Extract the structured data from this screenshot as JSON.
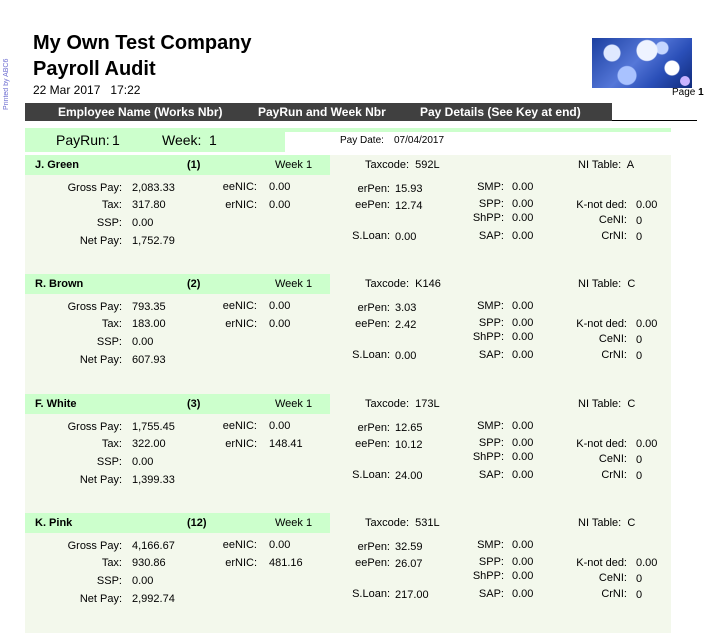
{
  "side_label": "Printed by ABC6",
  "company": "My Own Test Company",
  "report_title": "Payroll Audit",
  "date": "22 Mar 2017",
  "time": "17:22",
  "page": {
    "label": "Page",
    "number": "1"
  },
  "logo": "logo-image",
  "columns": {
    "employee": "Employee Name (Works Nbr)",
    "payrun": "PayRun and Week Nbr",
    "details": "Pay Details (See Key at end)"
  },
  "payrun": {
    "payrun_label": "PayRun:",
    "payrun_value": "1",
    "week_label": "Week:",
    "week_value": "1"
  },
  "pay_date": {
    "label": "Pay Date:",
    "value": "07/04/2017"
  },
  "labels": {
    "gross": "Gross Pay:",
    "tax": "Tax:",
    "ssp": "SSP:",
    "net": "Net Pay:",
    "eenic": "eeNIC:",
    "ernic": "erNIC:",
    "erpen": "erPen:",
    "eepen": "eePen:",
    "sloan": "S.Loan:",
    "smp": "SMP:",
    "spp": "SPP:",
    "shpp": "ShPP:",
    "sap": "SAP:",
    "knotded": "K-not ded:",
    "ceni": "CeNI:",
    "crni": "CrNI:",
    "week": "Week",
    "taxcode": "Taxcode:",
    "nitable": "NI Table:"
  },
  "employees": [
    {
      "name": "J. Green",
      "nbr": "(1)",
      "week": "1",
      "taxcode": "592L",
      "ni_table": "A",
      "gross": "2,083.33",
      "tax": "317.80",
      "ssp": "0.00",
      "net": "1,752.79",
      "eenic": "0.00",
      "ernic": "0.00",
      "erpen": "15.93",
      "eepen": "12.74",
      "sloan": "0.00",
      "smp": "0.00",
      "spp": "0.00",
      "shpp": "0.00",
      "sap": "0.00",
      "knotded": "0.00",
      "ceni": "0",
      "crni": "0"
    },
    {
      "name": "R. Brown",
      "nbr": "(2)",
      "week": "1",
      "taxcode": "K146",
      "ni_table": "C",
      "gross": "793.35",
      "tax": "183.00",
      "ssp": "0.00",
      "net": "607.93",
      "eenic": "0.00",
      "ernic": "0.00",
      "erpen": "3.03",
      "eepen": "2.42",
      "sloan": "0.00",
      "smp": "0.00",
      "spp": "0.00",
      "shpp": "0.00",
      "sap": "0.00",
      "knotded": "0.00",
      "ceni": "0",
      "crni": "0"
    },
    {
      "name": "F. White",
      "nbr": "(3)",
      "week": "1",
      "taxcode": "173L",
      "ni_table": "C",
      "gross": "1,755.45",
      "tax": "322.00",
      "ssp": "0.00",
      "net": "1,399.33",
      "eenic": "0.00",
      "ernic": "148.41",
      "erpen": "12.65",
      "eepen": "10.12",
      "sloan": "24.00",
      "smp": "0.00",
      "spp": "0.00",
      "shpp": "0.00",
      "sap": "0.00",
      "knotded": "0.00",
      "ceni": "0",
      "crni": "0"
    },
    {
      "name": "K. Pink",
      "nbr": "(12)",
      "week": "1",
      "taxcode": "531L",
      "ni_table": "C",
      "gross": "4,166.67",
      "tax": "930.86",
      "ssp": "0.00",
      "net": "2,992.74",
      "eenic": "0.00",
      "ernic": "481.16",
      "erpen": "32.59",
      "eepen": "26.07",
      "sloan": "217.00",
      "smp": "0.00",
      "spp": "0.00",
      "shpp": "0.00",
      "sap": "0.00",
      "knotded": "0.00",
      "ceni": "0",
      "crni": "0"
    }
  ]
}
